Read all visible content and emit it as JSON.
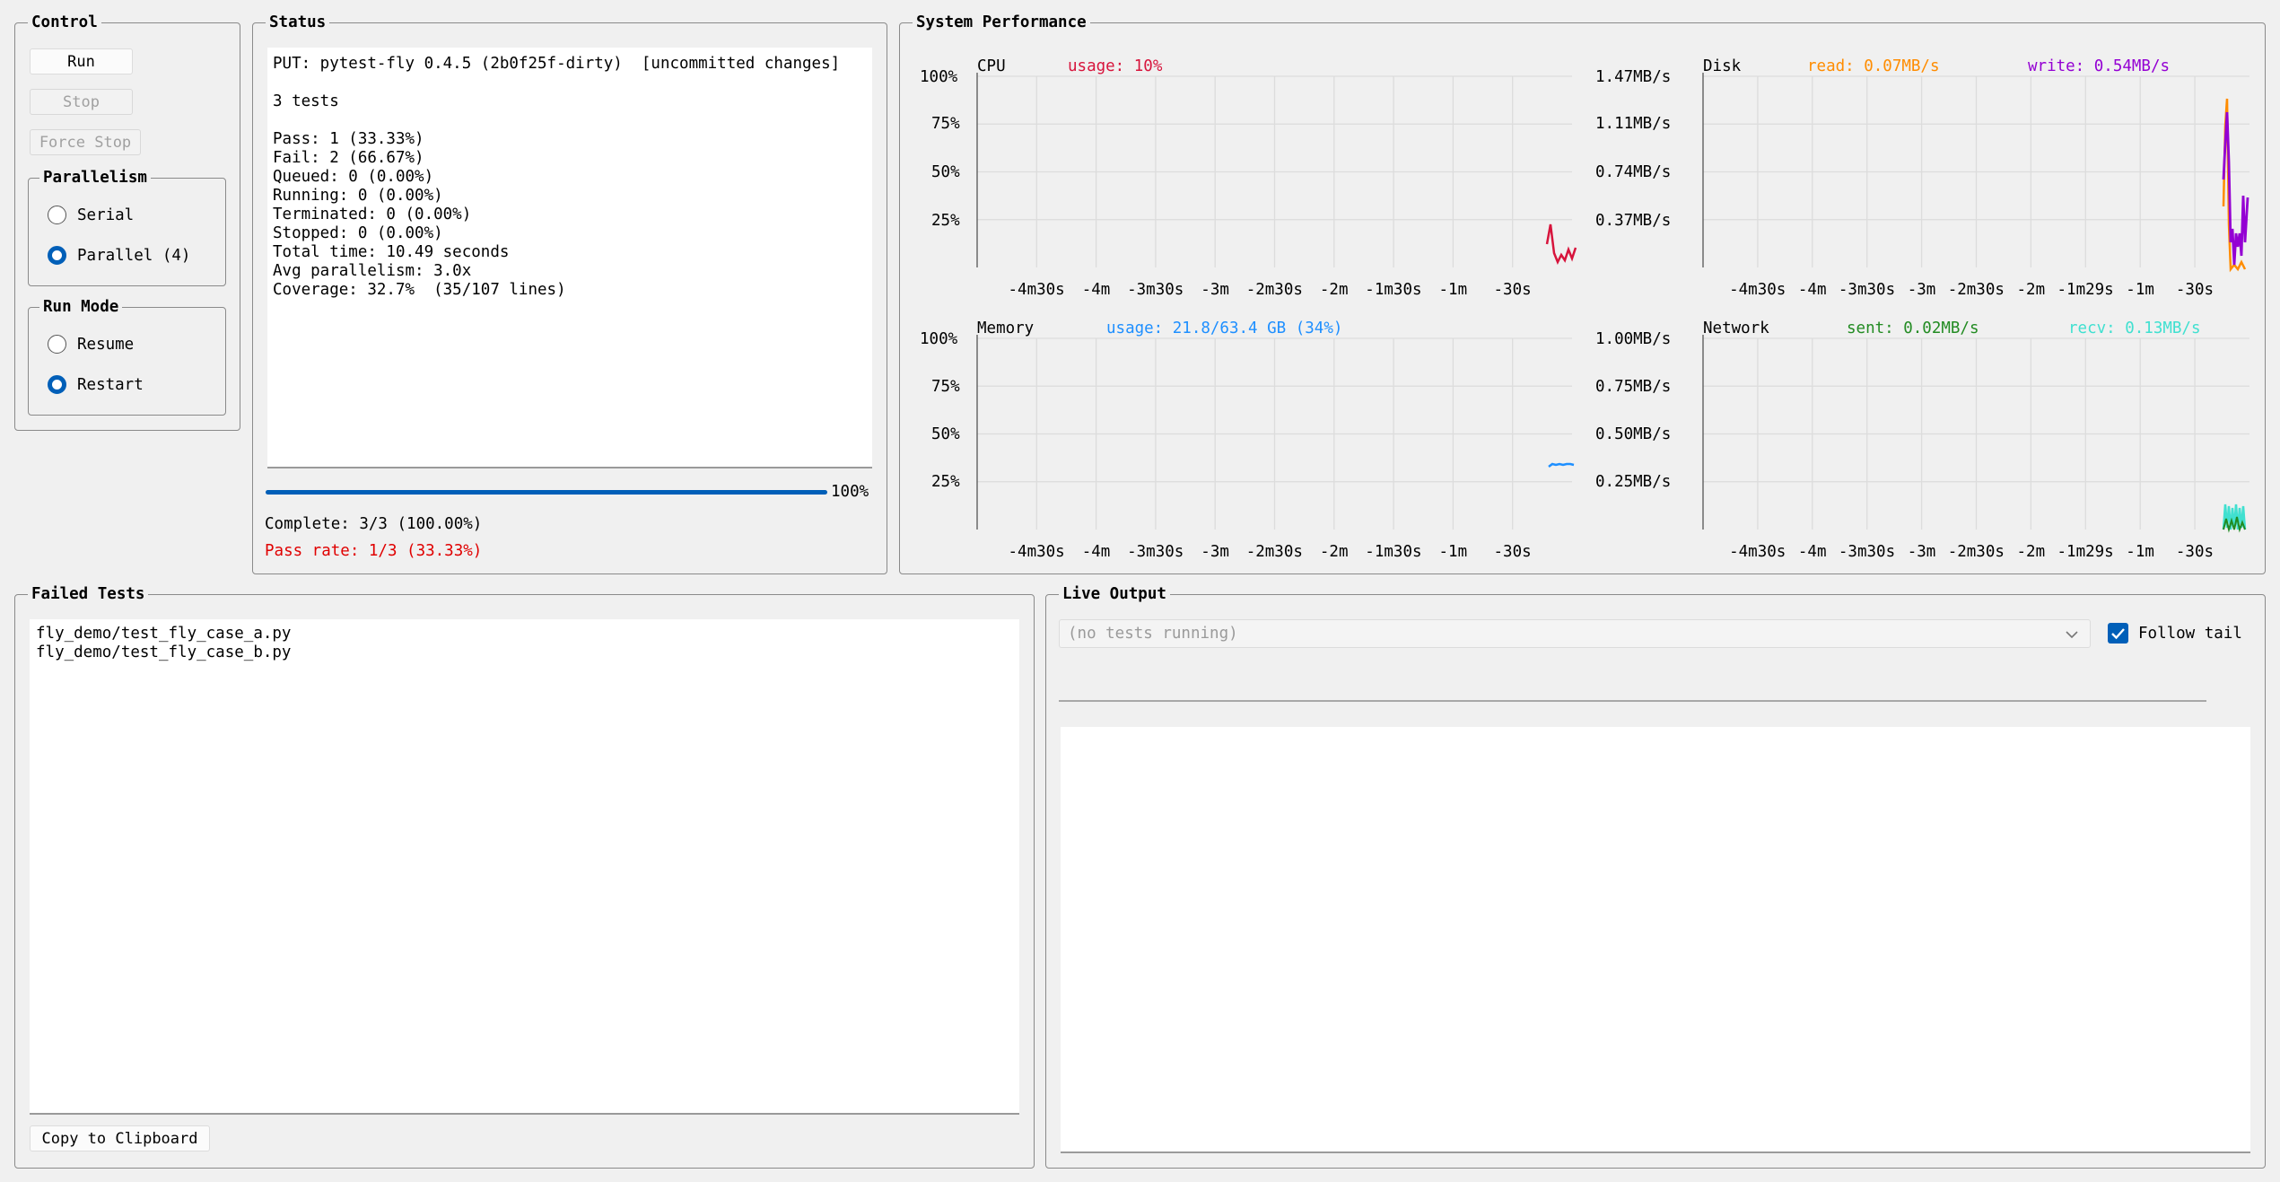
{
  "control": {
    "title": "Control",
    "run_label": "Run",
    "stop_label": "Stop",
    "force_stop_label": "Force Stop",
    "parallelism": {
      "title": "Parallelism",
      "options": [
        {
          "label": "Serial",
          "selected": false
        },
        {
          "label": "Parallel (4)",
          "selected": true
        }
      ]
    },
    "run_mode": {
      "title": "Run Mode",
      "options": [
        {
          "label": "Resume",
          "selected": false
        },
        {
          "label": "Restart",
          "selected": true
        }
      ]
    }
  },
  "status": {
    "title": "Status",
    "put_line": "PUT: pytest-fly 0.4.5 (2b0f25f-dirty)  [uncommitted changes]",
    "tests_line": "3 tests",
    "lines": [
      "Pass: 1 (33.33%)",
      "Fail: 2 (66.67%)",
      "Queued: 0 (0.00%)",
      "Running: 0 (0.00%)",
      "Terminated: 0 (0.00%)",
      "Stopped: 0 (0.00%)",
      "Total time: 10.49 seconds",
      "Avg parallelism: 3.0x",
      "Coverage: 32.7%  (35/107 lines)"
    ],
    "progress_percent": 100,
    "progress_label": "100%",
    "complete": "Complete: 3/3 (100.00%)",
    "pass_rate": "Pass rate: 1/3 (33.33%)",
    "pass_rate_color": "#e00000"
  },
  "system_performance": {
    "title": "System Performance",
    "x_ticks_a": [
      "-4m30s",
      "-4m",
      "-3m30s",
      "-3m",
      "-2m30s",
      "-2m",
      "-1m30s",
      "-1m",
      "-30s"
    ],
    "x_ticks_b": [
      "-4m30s",
      "-4m",
      "-3m30s",
      "-3m",
      "-2m30s",
      "-2m",
      "-1m29s",
      "-1m",
      "-30s"
    ],
    "cpu": {
      "name": "CPU",
      "usage_label": "usage: 10%",
      "color": "#d7143c",
      "y_ticks": [
        "100%",
        "75%",
        "50%",
        "25%"
      ]
    },
    "disk": {
      "name": "Disk",
      "read_label": "read: 0.07MB/s",
      "read_color": "#ff8c00",
      "write_label": "write: 0.54MB/s",
      "write_color": "#9400d3",
      "y_ticks": [
        "1.47MB/s",
        "1.11MB/s",
        "0.74MB/s",
        "0.37MB/s"
      ]
    },
    "memory": {
      "name": "Memory",
      "usage_label": "usage: 21.8/63.4 GB (34%)",
      "color": "#1e8fff",
      "y_ticks": [
        "100%",
        "75%",
        "50%",
        "25%"
      ]
    },
    "network": {
      "name": "Network",
      "sent_label": "sent: 0.02MB/s",
      "sent_color": "#228b22",
      "recv_label": "recv: 0.13MB/s",
      "recv_color": "#40e0d0",
      "y_ticks": [
        "1.00MB/s",
        "0.75MB/s",
        "0.50MB/s",
        "0.25MB/s"
      ]
    }
  },
  "failed_tests": {
    "title": "Failed Tests",
    "items": [
      "fly_demo/test_fly_case_a.py",
      "fly_demo/test_fly_case_b.py"
    ],
    "copy_label": "Copy to Clipboard"
  },
  "live_output": {
    "title": "Live Output",
    "select_value": "(no tests running)",
    "follow_tail_label": "Follow tail",
    "follow_tail_checked": true
  }
}
